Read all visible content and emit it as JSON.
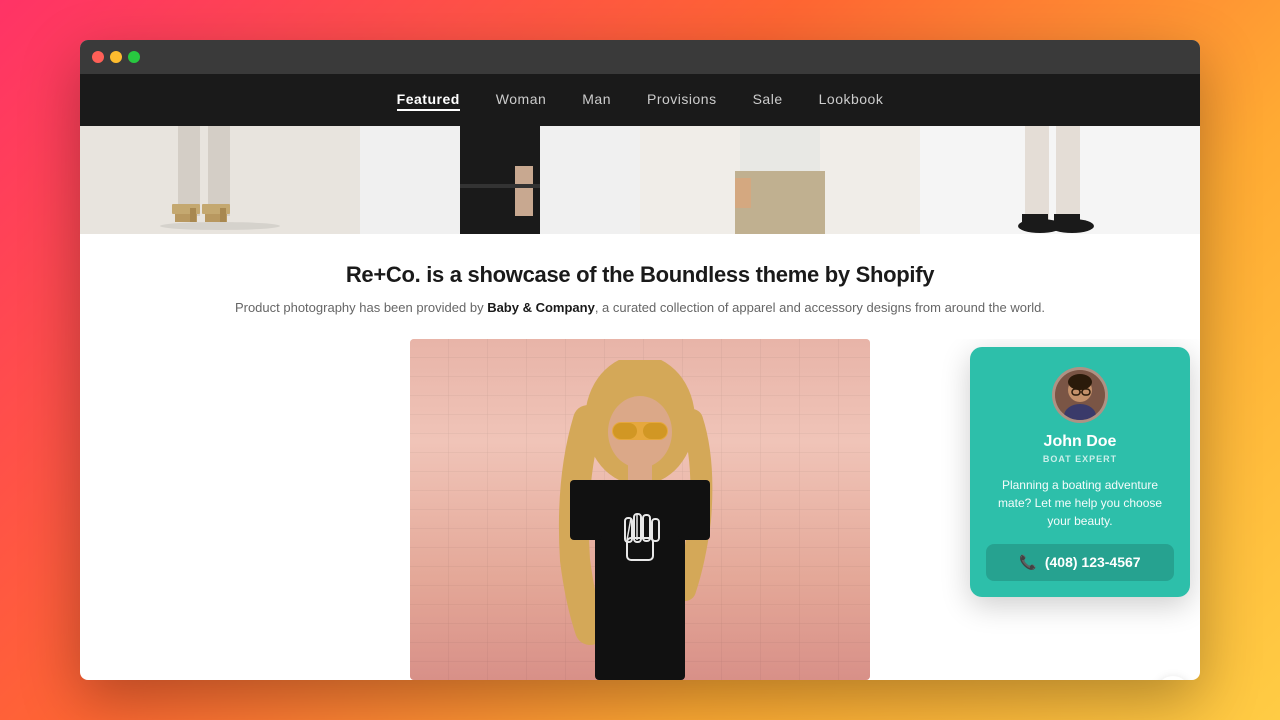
{
  "browser": {
    "dots": [
      "red",
      "yellow",
      "green"
    ]
  },
  "nav": {
    "items": [
      {
        "label": "Featured",
        "active": true
      },
      {
        "label": "Woman",
        "active": false
      },
      {
        "label": "Man",
        "active": false
      },
      {
        "label": "Provisions",
        "active": false
      },
      {
        "label": "Sale",
        "active": false
      },
      {
        "label": "Lookbook",
        "active": false
      }
    ]
  },
  "about": {
    "title": "Re+Co. is a showcase of the Boundless theme by Shopify",
    "intro": "Product photography has been provided by ",
    "brand": "Baby & Company",
    "description": ", a curated collection of apparel and accessory designs from around the world."
  },
  "chat_widget": {
    "name": "John Doe",
    "role": "BOAT EXPERT",
    "message": "Planning a boating adventure mate? Let me help you choose your beauty.",
    "phone": "(408) 123-4567"
  }
}
